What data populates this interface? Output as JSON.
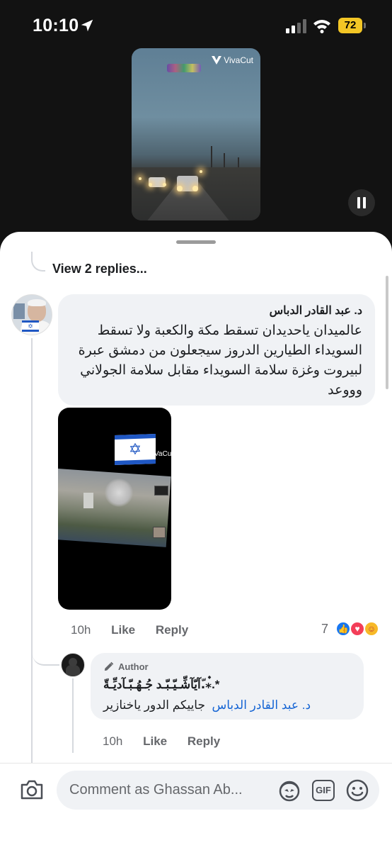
{
  "status_bar": {
    "time": "10:10",
    "battery": "72"
  },
  "video": {
    "watermark": "VivaCut"
  },
  "thread": {
    "view_replies": "View 2 replies..."
  },
  "comment": {
    "author": "د. عبد القادر الدباس",
    "text": "عالميدان ياحديدان تسقط مكة والكعبة ولا تسقط السويداء الطيارين الدروز سيجعلون من دمشق عبرة لبيروت وغزة سلامة السويداء مقابل سلامة الجولاني وووعد",
    "media_watermark": "VaCut",
    "time": "10h",
    "like_label": "Like",
    "reply_label": "Reply",
    "reaction_count": "7",
    "reactions": [
      "like",
      "love",
      "care"
    ]
  },
  "reply": {
    "badge": "Author",
    "author": "آيّآشِّـيّـبّـد جُـهُـبّـآديِّـةّ.ّ⁎๋.*",
    "mention": "د. عبد القادر الدباس",
    "text": "جاييكم الدور ياخنازير",
    "time": "10h",
    "like_label": "Like",
    "reply_label": "Reply"
  },
  "composer": {
    "placeholder": "Comment as Ghassan Ab...",
    "gif_label": "GIF"
  },
  "colors": {
    "accent": "#1877f2",
    "mention": "#1464d4",
    "battery": "#f3c625",
    "love": "#f33e58"
  }
}
